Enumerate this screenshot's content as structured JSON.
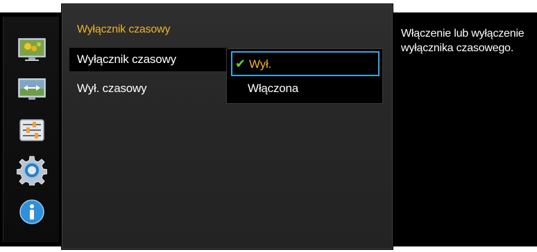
{
  "menu": {
    "title": "Wyłącznik czasowy",
    "items": [
      {
        "label": "Wyłącznik czasowy",
        "selected": true
      },
      {
        "label": "Wył. czasowy",
        "selected": false
      }
    ]
  },
  "dropdown": {
    "options": [
      {
        "label": "Wył.",
        "checked": true
      },
      {
        "label": "Włączona",
        "checked": false
      }
    ],
    "check_glyph": "✔"
  },
  "help": {
    "text": "Włączenie lub wyłączenie wyłącznika czasowego."
  },
  "sidebar": {
    "icons": [
      "picture-icon",
      "screen-size-icon",
      "adjust-sliders-icon",
      "settings-gear-icon",
      "info-icon"
    ]
  },
  "colors": {
    "title": "#f0b429",
    "focus_border": "#3aa7e0",
    "check": "#6fce2b"
  }
}
